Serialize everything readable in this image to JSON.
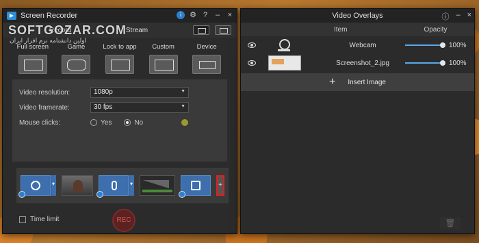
{
  "recorder": {
    "title": "Screen Recorder",
    "controls": [
      "ⓘ",
      "⚙",
      "?",
      "–",
      "×"
    ],
    "modes": {
      "record": "Record",
      "stream": "Stream"
    },
    "capture": [
      {
        "label": "Full screen"
      },
      {
        "label": "Game"
      },
      {
        "label": "Lock to app"
      },
      {
        "label": "Custom"
      },
      {
        "label": "Device"
      }
    ],
    "settings": {
      "resolution_label": "Video resolution:",
      "resolution_value": "1080p",
      "framerate_label": "Video framerate:",
      "framerate_value": "30 fps",
      "mouse_label": "Mouse clicks:",
      "yes_label": "Yes",
      "no_label": "No"
    },
    "plus_label": "+",
    "time_limit": "Time limit",
    "rec_label": "REC"
  },
  "overlays": {
    "title": "Video Overlays",
    "col_item": "Item",
    "col_opacity": "Opacity",
    "rows": [
      {
        "name": "Webcam",
        "opacity": "100%"
      },
      {
        "name": "Screenshot_2.jpg",
        "opacity": "100%"
      }
    ],
    "insert_label": "Insert Image"
  },
  "watermark": {
    "brand": "SOFTGOZAR.COM",
    "tagline": "اولین دانشنامه نرم افزار ایران"
  }
}
